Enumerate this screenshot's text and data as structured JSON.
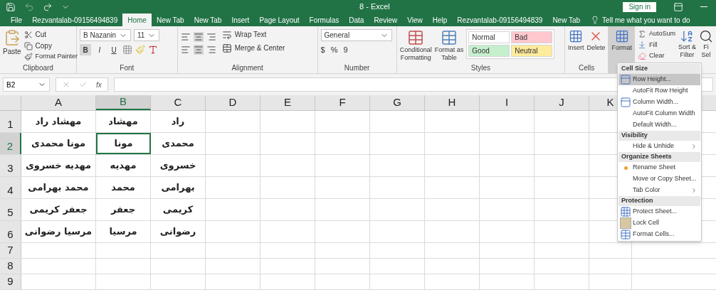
{
  "window": {
    "title": "8  -  Excel",
    "sign_in": "Sign in"
  },
  "tabs": [
    {
      "label": "File",
      "selected": false
    },
    {
      "label": "Rezvantalab-09156494839",
      "selected": false
    },
    {
      "label": "Home",
      "selected": true
    },
    {
      "label": "New Tab",
      "selected": false
    },
    {
      "label": "New Tab",
      "selected": false
    },
    {
      "label": "Insert",
      "selected": false
    },
    {
      "label": "Page Layout",
      "selected": false
    },
    {
      "label": "Formulas",
      "selected": false
    },
    {
      "label": "Data",
      "selected": false
    },
    {
      "label": "Review",
      "selected": false
    },
    {
      "label": "View",
      "selected": false
    },
    {
      "label": "Help",
      "selected": false
    },
    {
      "label": "Rezvantalab-09156494839",
      "selected": false
    },
    {
      "label": "New Tab",
      "selected": false
    }
  ],
  "tell_me": {
    "placeholder": "Tell me what you want to do"
  },
  "ribbon": {
    "clipboard": {
      "paste": "Paste",
      "cut": "Cut",
      "copy": "Copy",
      "format_painter": "Format Painter",
      "label": "Clipboard"
    },
    "font": {
      "name": "B Nazanin",
      "size": "11",
      "bold": "B",
      "italic": "I",
      "underline": "U",
      "label": "Font"
    },
    "alignment": {
      "wrap_text": "Wrap Text",
      "merge_center": "Merge & Center",
      "label": "Alignment"
    },
    "number": {
      "format": "General",
      "currency": "$",
      "percent": "%",
      "comma": "9",
      "label": "Number"
    },
    "styles": {
      "conditional": [
        "Conditional",
        "Formatting"
      ],
      "format_table": [
        "Format as",
        "Table"
      ],
      "cells": [
        {
          "label": "Normal",
          "color": "#ffffff"
        },
        {
          "label": "Bad",
          "color": "#ffc7ce"
        },
        {
          "label": "Good",
          "color": "#c6efce"
        },
        {
          "label": "Neutral",
          "color": "#ffeb9c"
        }
      ],
      "label": "Styles"
    },
    "cells": {
      "insert": "Insert",
      "delete": "Delete",
      "format": "Format",
      "label": "Cells"
    },
    "editing": {
      "autosum": "AutoSum",
      "fill": "Fill",
      "clear": "Clear",
      "sort": [
        "Sort &",
        "Filter"
      ],
      "find": [
        "Fi",
        "Sel"
      ]
    }
  },
  "formula_bar": {
    "name_box": "B2",
    "fx": "fx"
  },
  "sheet": {
    "columns": [
      {
        "label": "A",
        "selected": false,
        "cells": [
          {
            "text": "مهشاد راد",
            "selected": false
          },
          {
            "text": "مونا محمدی",
            "selected": false
          },
          {
            "text": "مهدیه خسروی",
            "selected": false
          },
          {
            "text": "محمد بهرامی",
            "selected": false
          },
          {
            "text": "جعفر کریمی",
            "selected": false
          },
          {
            "text": "مرسیا رضوانی",
            "selected": false
          }
        ]
      },
      {
        "label": "B",
        "selected": true,
        "cells": [
          {
            "text": "مهشاد",
            "selected": false
          },
          {
            "text": "مونا",
            "selected": true
          },
          {
            "text": "مهدیه",
            "selected": false
          },
          {
            "text": "محمد",
            "selected": false
          },
          {
            "text": "جعفر",
            "selected": false
          },
          {
            "text": "مرسیا",
            "selected": false
          }
        ]
      },
      {
        "label": "C",
        "selected": false,
        "cells": [
          {
            "text": "راد",
            "selected": false
          },
          {
            "text": "محمدی",
            "selected": false
          },
          {
            "text": "خسروی",
            "selected": false
          },
          {
            "text": "بهرامی",
            "selected": false
          },
          {
            "text": "کریمی",
            "selected": false
          },
          {
            "text": "رضوانی",
            "selected": false
          }
        ]
      },
      {
        "label": "D",
        "selected": false
      },
      {
        "label": "E",
        "selected": false
      },
      {
        "label": "F",
        "selected": false
      },
      {
        "label": "G",
        "selected": false
      },
      {
        "label": "H",
        "selected": false
      },
      {
        "label": "I",
        "selected": false
      },
      {
        "label": "J",
        "selected": false
      },
      {
        "label": "K",
        "selected": false
      }
    ],
    "rows": [
      {
        "label": "1",
        "selected": false
      },
      {
        "label": "2",
        "selected": true
      },
      {
        "label": "3",
        "selected": false
      },
      {
        "label": "4",
        "selected": false
      },
      {
        "label": "5",
        "selected": false
      },
      {
        "label": "6",
        "selected": false
      },
      {
        "label": "7",
        "selected": false
      },
      {
        "label": "8",
        "selected": false
      },
      {
        "label": "9",
        "selected": false
      }
    ]
  },
  "format_menu": [
    {
      "header": "Cell Size",
      "items": [
        {
          "label": "Row Height...",
          "kind": "rowsize",
          "selected": true
        },
        {
          "label": "AutoFit Row Height",
          "kind": "plain",
          "selected": false
        },
        {
          "label": "Column Width...",
          "kind": "colsize",
          "selected": false
        },
        {
          "label": "AutoFit Column Width",
          "kind": "plain",
          "selected": false
        },
        {
          "label": "Default Width...",
          "kind": "plain",
          "selected": false
        }
      ]
    },
    {
      "header": "Visibility",
      "items": [
        {
          "label": "Hide & Unhide",
          "kind": "submenu",
          "selected": false
        }
      ]
    },
    {
      "header": "Organize Sheets",
      "items": [
        {
          "label": "Rename Sheet",
          "kind": "marked",
          "selected": false
        },
        {
          "label": "Move or Copy Sheet...",
          "kind": "plain",
          "selected": false
        },
        {
          "label": "Tab Color",
          "kind": "submenu",
          "selected": false
        }
      ]
    },
    {
      "header": "Protection",
      "items": [
        {
          "label": "Protect Sheet...",
          "kind": "protect",
          "selected": false
        },
        {
          "label": "Lock Cell",
          "kind": "lock",
          "selected": false
        },
        {
          "label": "Format Cells...",
          "kind": "dialog",
          "selected": false
        }
      ]
    }
  ]
}
